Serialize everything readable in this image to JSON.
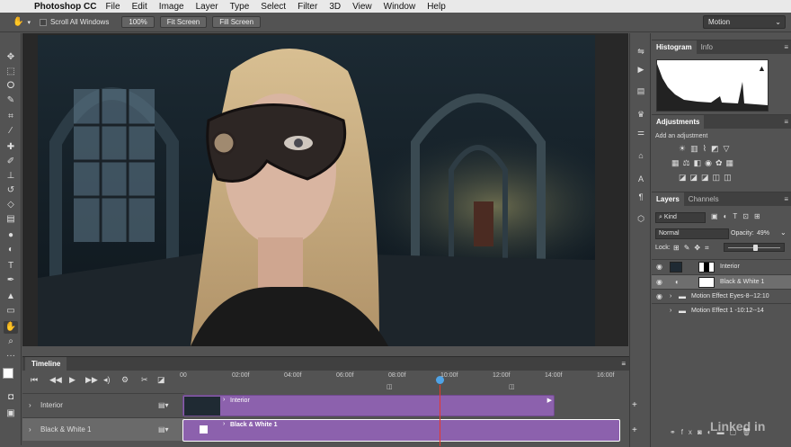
{
  "menubar": {
    "app_name": "Photoshop CC",
    "items": [
      "File",
      "Edit",
      "Image",
      "Layer",
      "Type",
      "Select",
      "Filter",
      "3D",
      "View",
      "Window",
      "Help"
    ]
  },
  "options": {
    "scroll_all_windows": "Scroll All Windows",
    "zoom_100": "100%",
    "fit_screen": "Fit Screen",
    "fill_screen": "Fill Screen",
    "workspace": "Motion"
  },
  "panels": {
    "histogram_tab": "Histogram",
    "info_tab": "Info",
    "adjustments_tab": "Adjustments",
    "add_adjustment": "Add an adjustment",
    "layers_tab": "Layers",
    "channels_tab": "Channels",
    "filter_kind": "Kind",
    "blend_mode": "Normal",
    "opacity_label": "Opacity:",
    "opacity_value": "49%",
    "lock_label": "Lock:"
  },
  "layers": [
    {
      "name": "Interior",
      "visible": true
    },
    {
      "name": "Black & White 1",
      "visible": true,
      "selected": true
    },
    {
      "name": "Motion Effect Eyes-8--12:10",
      "visible": true
    },
    {
      "name": "Motion Effect 1 -10:12--14",
      "visible": false
    }
  ],
  "timeline": {
    "title": "Timeline",
    "ticks": [
      "00",
      "02:00f",
      "04:00f",
      "06:00f",
      "08:00f",
      "10:00f",
      "12:00f",
      "14:00f",
      "16:00f"
    ],
    "tracks": [
      {
        "name": "Interior",
        "clip": "Interior"
      },
      {
        "name": "Black & White 1",
        "clip": "Black & White 1"
      }
    ]
  },
  "watermark": "Linked in",
  "colors": {
    "clip_purple": "#8c61ad",
    "playhead": "#e8372b",
    "selected_layer": "#6e6e6e"
  }
}
